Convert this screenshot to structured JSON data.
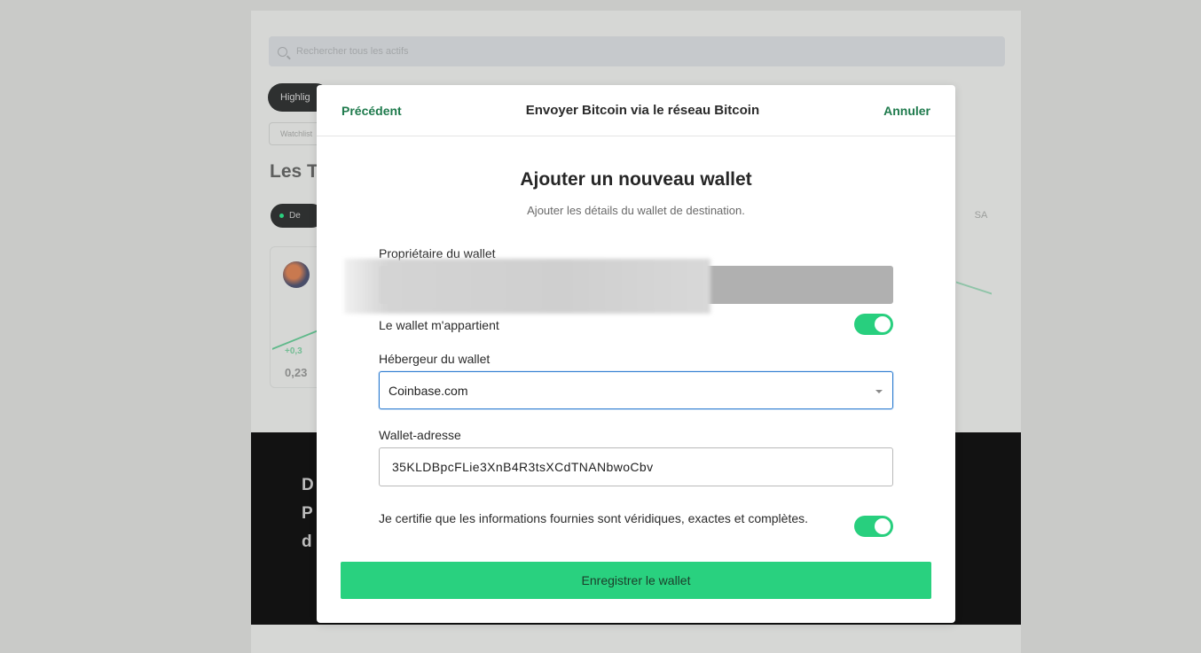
{
  "background": {
    "search_placeholder": "Rechercher tous les actifs",
    "pill_dark_label": "Highlig",
    "chip_label": "Watchlist",
    "heading": "Les T",
    "pill_green_label": "De",
    "right_pill_label": "SA",
    "card_change": "+0,3",
    "card_price": "0,23",
    "banner_lines": [
      "D",
      "P",
      "d"
    ]
  },
  "modal": {
    "header": {
      "back_label": "Précédent",
      "title": "Envoyer Bitcoin via le réseau Bitcoin",
      "cancel_label": "Annuler"
    },
    "title": "Ajouter un nouveau wallet",
    "subtitle": "Ajouter les détails du wallet de destination.",
    "owner_label": "Propriétaire du wallet",
    "owner_value_redacted": true,
    "own_wallet_label": "Le wallet m'appartient",
    "own_wallet_on": true,
    "host_label": "Hébergeur du wallet",
    "host_value": "Coinbase.com",
    "address_label": "Wallet-adresse",
    "address_value": "35KLDBpcFLie3XnB4R3tsXCdTNANbwoCbv",
    "certify_label": "Je certifie que les informations fournies sont véridiques, exactes et complètes.",
    "certify_on": true,
    "save_label": "Enregistrer le wallet"
  },
  "colors": {
    "accent_green": "#29d17f",
    "link_green": "#1e7a4c",
    "focus_blue": "#2b7bd0"
  }
}
